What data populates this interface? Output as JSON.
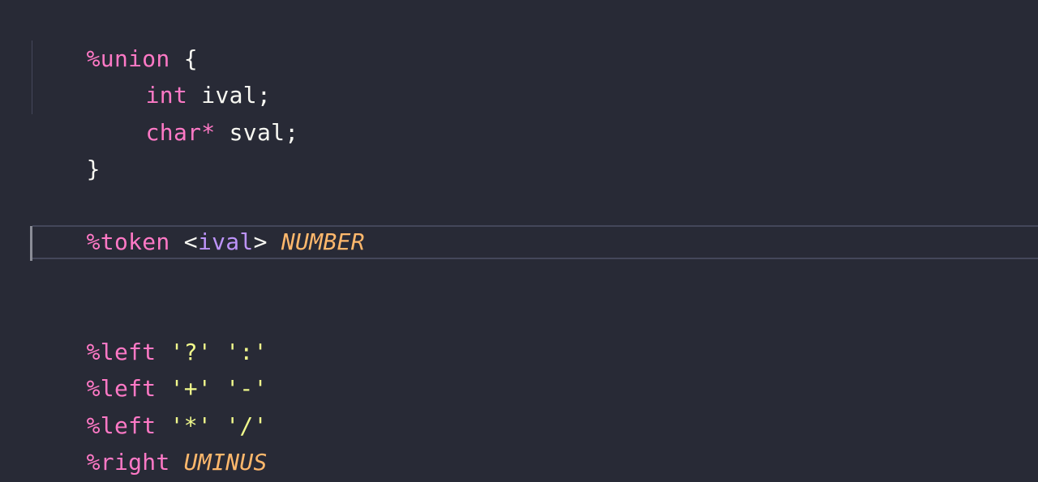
{
  "lines": [
    {
      "tokens": [
        "%union",
        " ",
        "{"
      ]
    },
    {
      "tokens": [
        "int",
        " ",
        "ival",
        ";"
      ]
    },
    {
      "tokens": [
        "char",
        "*",
        " ",
        "sval",
        ";"
      ]
    },
    {
      "tokens": [
        "}"
      ]
    },
    {
      "tokens": []
    },
    {
      "tokens": [
        "%token",
        " ",
        "<",
        "ival",
        ">",
        " ",
        "NUMBER"
      ]
    },
    {
      "tokens": []
    },
    {
      "tokens": []
    },
    {
      "tokens": [
        "%left",
        " ",
        "'?'",
        " ",
        "':'"
      ]
    },
    {
      "tokens": [
        "%left",
        " ",
        "'+'",
        " ",
        "'-'"
      ]
    },
    {
      "tokens": [
        "%left",
        " ",
        "'*'",
        " ",
        "'/'"
      ]
    },
    {
      "tokens": [
        "%right",
        " ",
        "UMINUS"
      ]
    }
  ],
  "colors": {
    "background": "#282a36",
    "foreground": "#f8f8f2",
    "keyword": "#ff79c6",
    "tag": "#bd93f9",
    "constant": "#ffb86c",
    "string": "#f1fa8c",
    "current_line_border": "#44475a"
  }
}
